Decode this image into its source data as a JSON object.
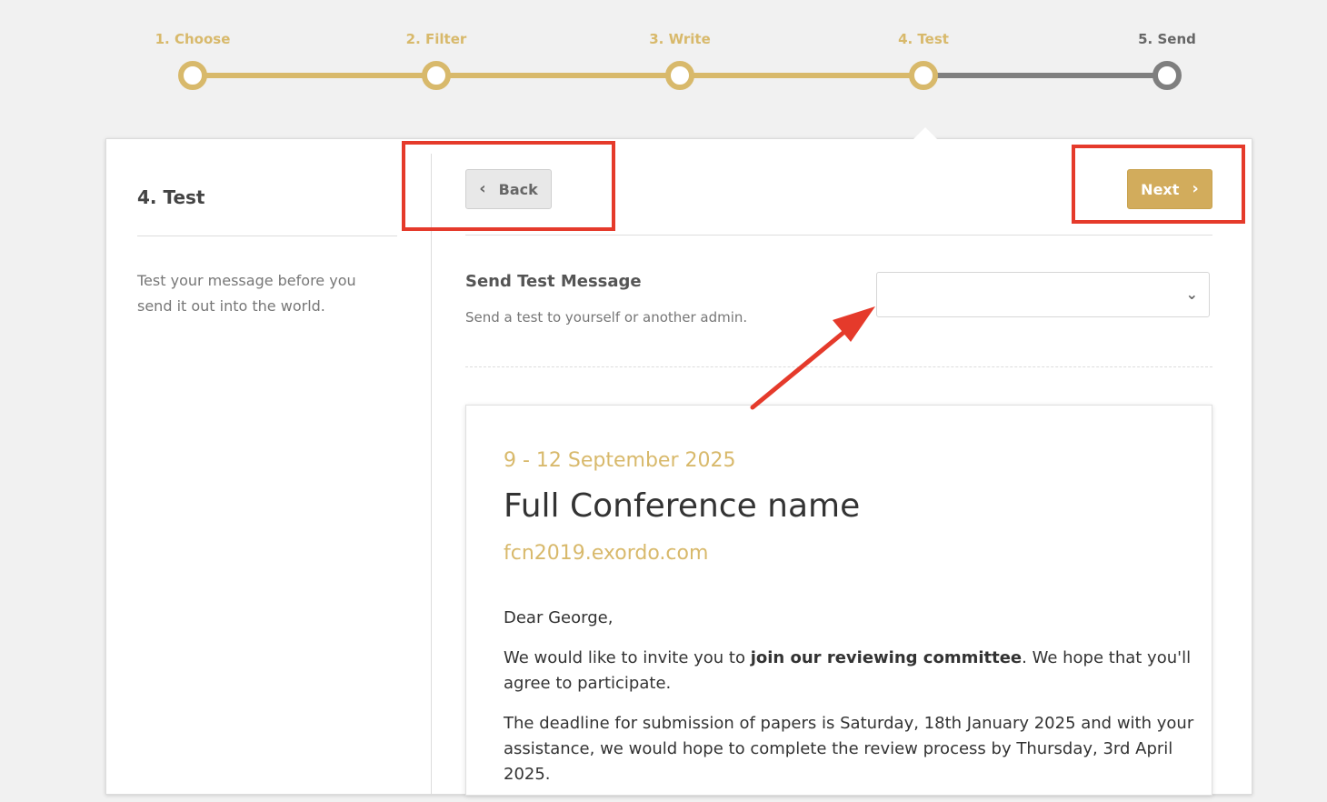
{
  "stepper": {
    "steps": [
      {
        "label": "1. Choose",
        "state": "complete"
      },
      {
        "label": "2. Filter",
        "state": "complete"
      },
      {
        "label": "3. Write",
        "state": "complete"
      },
      {
        "label": "4. Test",
        "state": "current"
      },
      {
        "label": "5. Send",
        "state": "pending"
      }
    ],
    "active_color": "#d8b96b",
    "pending_color": "#7f7f7f"
  },
  "sidebar": {
    "title": "4. Test",
    "description": "Test your message before you send it out into the world."
  },
  "toolbar": {
    "back_label": "Back",
    "next_label": "Next",
    "next_color": "#d2ac5c"
  },
  "send_test": {
    "title": "Send Test Message",
    "help": "Send a test to yourself or another admin.",
    "select_value": ""
  },
  "preview": {
    "date": "9 - 12 September 2025",
    "conference_name": "Full Conference name",
    "url": "fcn2019.exordo.com",
    "greeting": "Dear George,",
    "p1_before": "We would like to invite you to ",
    "p1_bold": "join our reviewing committee",
    "p1_after": ". We hope that you'll agree to participate.",
    "p2": "The deadline for submission of papers is Saturday, 18th January 2025 and with your assistance, we would hope to complete the review process by Thursday, 3rd April 2025."
  },
  "annotations": {
    "color": "#e53a2b"
  }
}
